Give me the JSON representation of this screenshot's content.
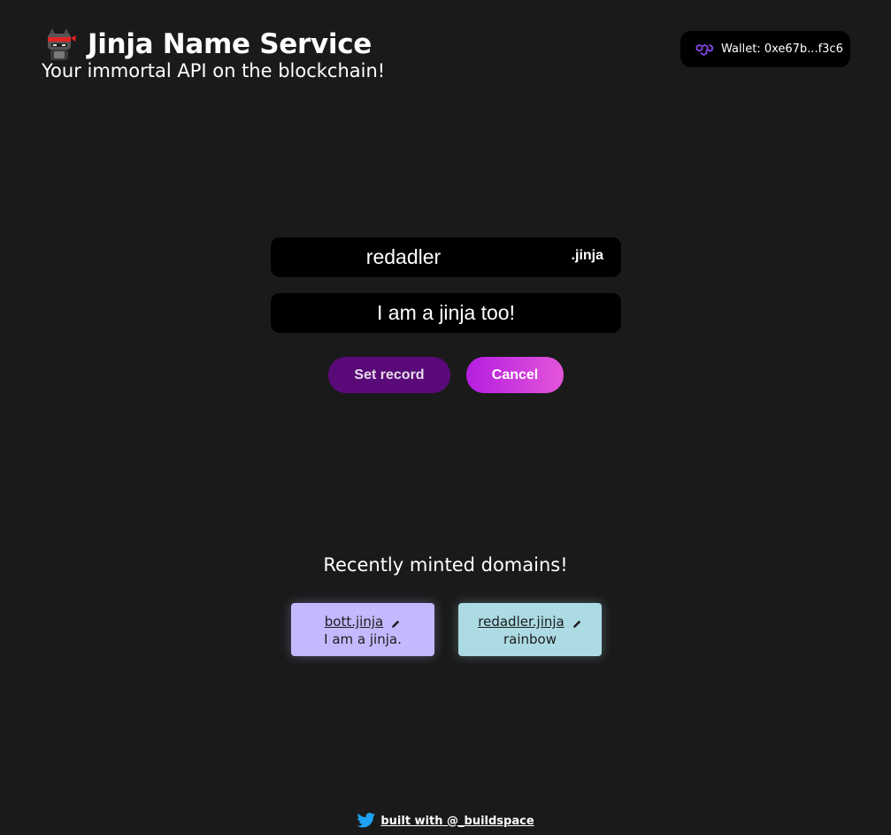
{
  "header": {
    "title": "Jinja Name Service",
    "subtitle": "Your immortal API on the blockchain!",
    "logo_icon": "ninja-cat-icon"
  },
  "wallet": {
    "label": "Wallet: 0xe67b...f3c6",
    "icon": "polygon-icon"
  },
  "form": {
    "domain_value": "redadler",
    "tld": ".jinja",
    "record_value": "I am a jinja too!",
    "set_record_label": "Set record",
    "cancel_label": "Cancel"
  },
  "recent": {
    "title": "Recently minted domains!",
    "items": [
      {
        "name": "bott.jinja",
        "record": "I am a jinja."
      },
      {
        "name": "redadler.jinja",
        "record": "rainbow"
      }
    ]
  },
  "footer": {
    "text": "built with @_buildspace",
    "icon": "twitter-icon"
  },
  "colors": {
    "background": "#1a1a1a",
    "set_record_button": "#5a0a78",
    "cancel_gradient_start": "#b41ee0",
    "cancel_gradient_end": "#e455da",
    "card_1": "#c4b9ff",
    "card_2": "#acdbe4",
    "polygon_purple": "#8247e5",
    "twitter_blue": "#1da1f2"
  }
}
